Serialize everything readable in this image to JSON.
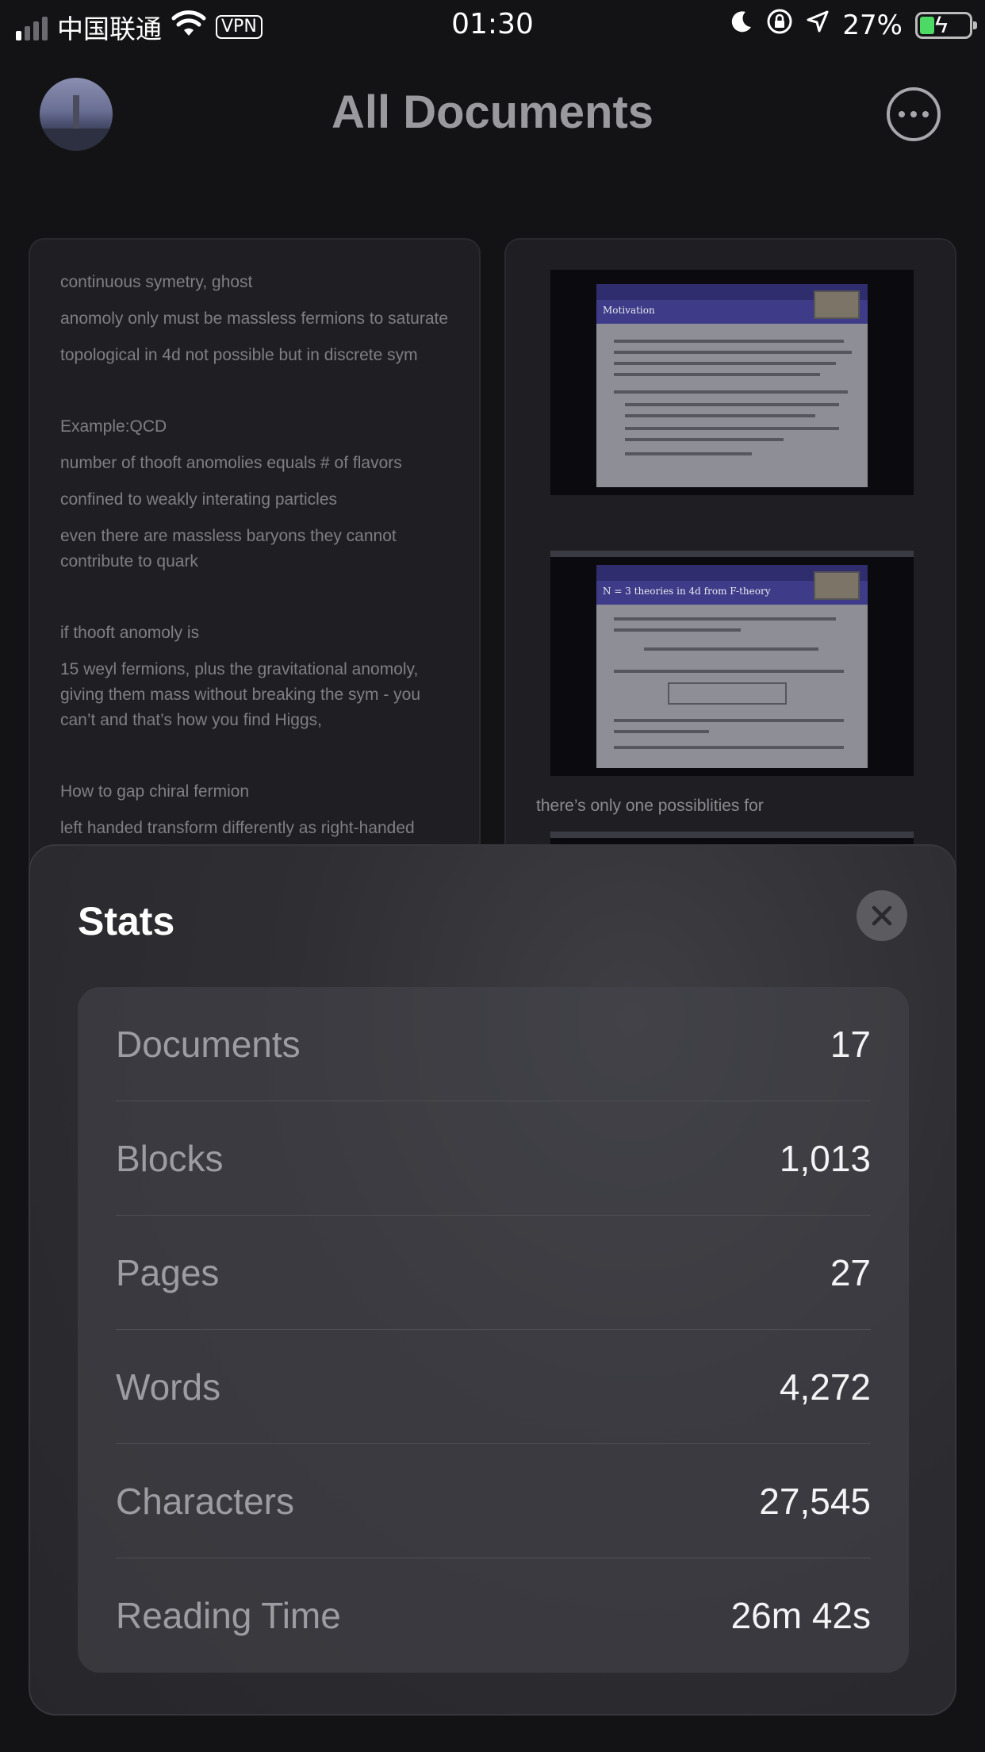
{
  "status_bar": {
    "carrier": "中国联通",
    "vpn": "VPN",
    "time": "01:30",
    "battery_percent": "27%",
    "signal_bars": 4,
    "signal_active": 1,
    "icons": [
      "wifi-icon",
      "moon-icon",
      "rotation-lock-icon",
      "location-icon",
      "battery-charging-icon"
    ]
  },
  "header": {
    "title": "All Documents",
    "avatar": "avatar",
    "more_icon": "more-icon"
  },
  "documents": {
    "left_card_lines": [
      "continuous symetry, ghost",
      "anomoly only must be massless fermions to saturate",
      "topological in 4d not possible but in discrete sym",
      "",
      "Example:QCD",
      "number of thooft anomolies equals # of flavors",
      "confined to weakly interating particles",
      "even there are massless baryons they cannot contribute to quark",
      "",
      "if thooft anomoly is",
      "15 weyl fermions, plus the gravitational anomoly, giving them mass without breaking the sym - you can’t and that’s how you find Higgs,",
      "",
      "How to gap chiral fermion",
      "left handed transform differently as right-handed"
    ],
    "right_card": {
      "slide1_title": "Motivation",
      "slide2_title": "N = 3 theories in 4d from F-theory",
      "caption": "there’s only one possiblities for"
    }
  },
  "stats": {
    "title": "Stats",
    "close_icon": "close-icon",
    "rows": [
      {
        "label": "Documents",
        "value": "17"
      },
      {
        "label": "Blocks",
        "value": "1,013"
      },
      {
        "label": "Pages",
        "value": "27"
      },
      {
        "label": "Words",
        "value": "4,272"
      },
      {
        "label": "Characters",
        "value": "27,545"
      },
      {
        "label": "Reading Time",
        "value": "26m 42s"
      }
    ]
  },
  "colors": {
    "background": "#131316",
    "card": "#1f1f23",
    "sheet": "#2f2f33",
    "battery_green": "#4cd964"
  }
}
